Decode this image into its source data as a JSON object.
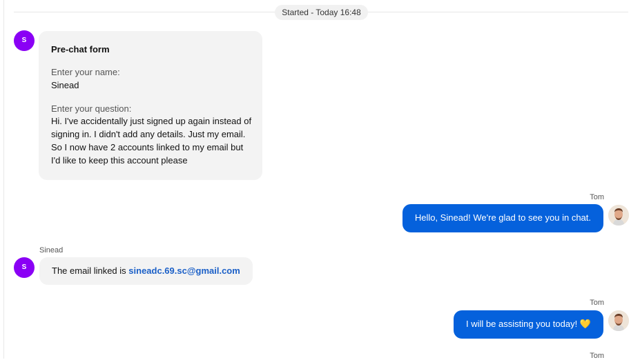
{
  "divider": {
    "label": "Started - Today 16:48"
  },
  "visitor": {
    "initial": "S",
    "name": "Sinead",
    "avatar_color": "#8a00f5"
  },
  "agent": {
    "name": "Tom"
  },
  "prechat": {
    "title": "Pre-chat form",
    "name_label": "Enter your name:",
    "name_value": "Sinead",
    "question_label": "Enter your question:",
    "question_value": "Hi. I've accidentally just signed up again instead of signing in. I didn't add any details. Just my email. So I now have 2 accounts linked to my email but I'd like to keep this account please"
  },
  "messages": [
    {
      "sender": "Tom",
      "text": "Hello, Sinead! We're glad to see you in chat."
    },
    {
      "sender": "Sinead",
      "text_prefix": "The email linked is ",
      "email": "sineadc.69.sc@gmail.com"
    },
    {
      "sender": "Tom",
      "text": "I will be assisting you today!",
      "emoji": "💛"
    },
    {
      "sender": "Tom"
    }
  ],
  "colors": {
    "outgoing_bubble": "#0561dc",
    "incoming_bubble": "#f3f3f3",
    "link": "#1a5fc7"
  }
}
